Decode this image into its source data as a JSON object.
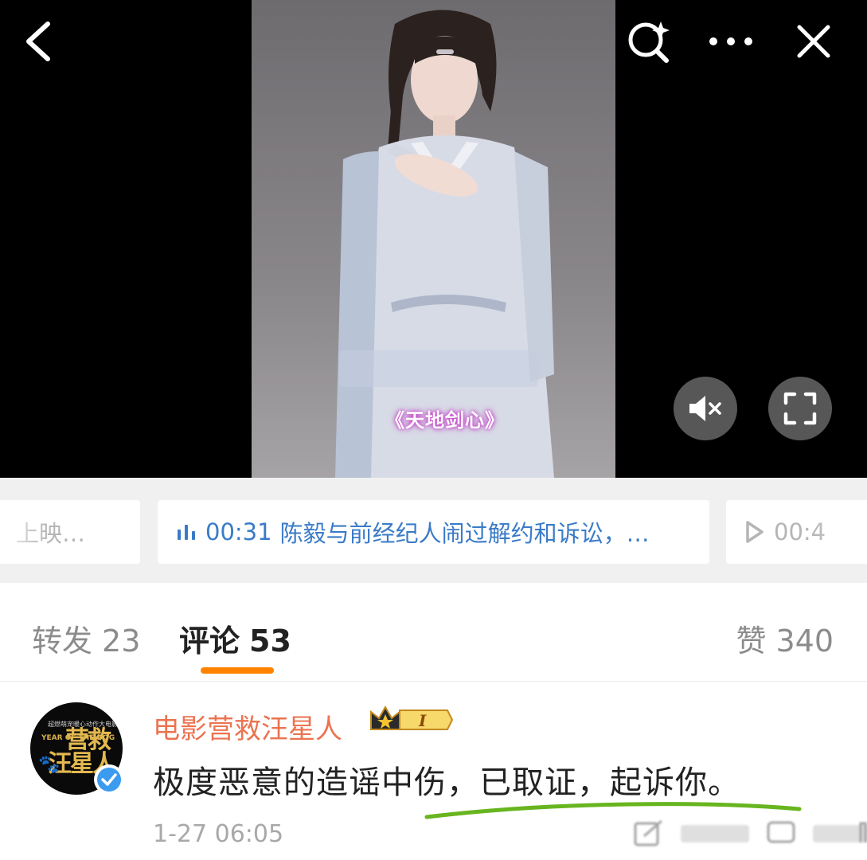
{
  "video": {
    "caption": "《天地剑心》",
    "top_bar": {
      "back_icon": "chevron-left-icon",
      "search_icon": "ai-search-icon",
      "more_icon": "ellipsis-icon",
      "close_icon": "close-icon"
    },
    "controls": {
      "mute_icon": "speaker-muted-icon",
      "fullscreen_icon": "fullscreen-icon"
    }
  },
  "chapters": {
    "prev": {
      "label": "上映…"
    },
    "active": {
      "time": "00:31",
      "label": "陈毅与前经纪人闹过解约和诉讼，…",
      "icon": "audio-bars-icon"
    },
    "next": {
      "time": "00:4",
      "icon": "play-icon"
    }
  },
  "tabs": {
    "repost": {
      "label": "转发",
      "count": "23"
    },
    "comments": {
      "label": "评论",
      "count": "53"
    },
    "likes": {
      "label": "赞",
      "count": "340"
    }
  },
  "comment": {
    "username": "电影营救汪星人",
    "badge_level": "I",
    "text": "极度恶意的造谣中伤，已取证，起诉你。",
    "timestamp": "1-27 06:05",
    "avatar": {
      "top_text": "超燃萌宠暖心动作大电影",
      "year_text": "YEAR OF THE DOG",
      "logo_line1": "营救",
      "logo_line2": "汪星人"
    }
  },
  "colors": {
    "accent_orange": "#ff8200",
    "username": "#eb7350",
    "link_blue": "#3a7bc8",
    "highlight_green": "#67b51f"
  }
}
